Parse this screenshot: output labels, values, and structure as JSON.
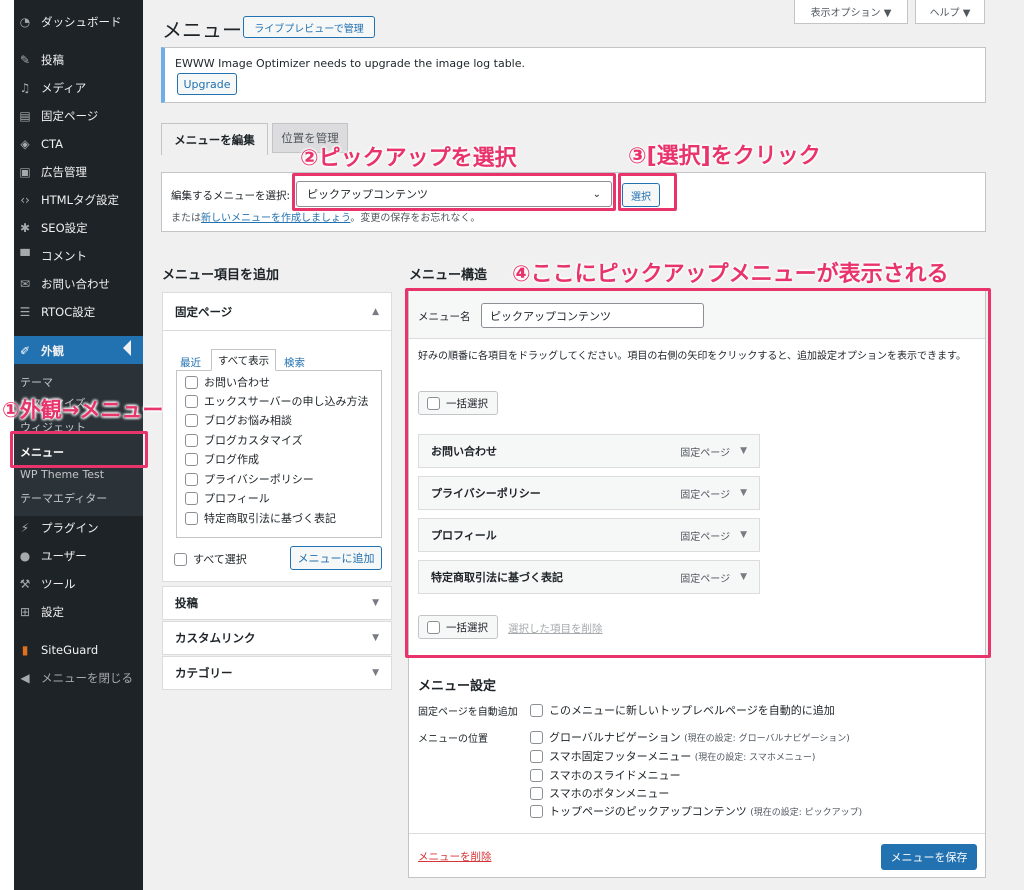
{
  "sidebar": {
    "items": [
      {
        "label": "ダッシュボード",
        "icon": "dashboard-icon"
      },
      {
        "label": "投稿",
        "icon": "pin-icon"
      },
      {
        "label": "メディア",
        "icon": "media-icon"
      },
      {
        "label": "固定ページ",
        "icon": "page-icon"
      },
      {
        "label": "CTA",
        "icon": "cta-icon"
      },
      {
        "label": "広告管理",
        "icon": "ad-icon"
      },
      {
        "label": "HTMLタグ設定",
        "icon": "code-icon"
      },
      {
        "label": "SEO設定",
        "icon": "gear-icon"
      },
      {
        "label": "コメント",
        "icon": "comment-icon"
      },
      {
        "label": "お問い合わせ",
        "icon": "mail-icon"
      },
      {
        "label": "RTOC設定",
        "icon": "list-icon"
      },
      {
        "label": "外観",
        "icon": "appearance-icon"
      },
      {
        "label": "プラグイン",
        "icon": "plugin-icon"
      },
      {
        "label": "ユーザー",
        "icon": "user-icon"
      },
      {
        "label": "ツール",
        "icon": "wrench-icon"
      },
      {
        "label": "設定",
        "icon": "settings-icon"
      },
      {
        "label": "SiteGuard",
        "icon": "siteguard-icon"
      },
      {
        "label": "メニューを閉じる",
        "icon": "collapse-icon"
      }
    ],
    "submenu": [
      "テーマ",
      "カスタマイズ",
      "ウィジェット",
      "メニュー",
      "WP Theme Test",
      "テーマエディター"
    ]
  },
  "header": {
    "title": "メニュー",
    "live_preview": "ライブプレビューで管理",
    "screen_options": "表示オプション ▼",
    "help": "ヘルプ ▼"
  },
  "notice": {
    "text": "EWWW Image Optimizer needs to upgrade the image log table.",
    "button": "Upgrade"
  },
  "tabs": [
    "メニューを編集",
    "位置を管理"
  ],
  "select_menu": {
    "label": "編集するメニューを選択:",
    "value": "ピックアップコンテンツ",
    "button": "選択",
    "or_text": "または",
    "create_link": "新しいメニューを作成しましょう",
    "note": "。変更の保存をお忘れなく。"
  },
  "add_items": {
    "heading": "メニュー項目を追加",
    "panel_title": "固定ページ",
    "tabs": [
      "最近",
      "すべて表示",
      "検索"
    ],
    "pages": [
      "お問い合わせ",
      "エックスサーバーの申し込み方法",
      "ブログお悩み相談",
      "ブログカスタマイズ",
      "ブログ作成",
      "プライバシーポリシー",
      "プロフィール",
      "特定商取引法に基づく表記"
    ],
    "select_all": "すべて選択",
    "add_button": "メニューに追加",
    "other_panels": [
      "投稿",
      "カスタムリンク",
      "カテゴリー"
    ]
  },
  "structure": {
    "heading": "メニュー構造",
    "name_label": "メニュー名",
    "name_value": "ピックアップコンテンツ",
    "instructions": "好みの順番に各項目をドラッグしてください。項目の右側の矢印をクリックすると、追加設定オプションを表示できます。",
    "bulk_select": "一括選択",
    "delete_selected": "選択した項目を削除",
    "items": [
      {
        "title": "お問い合わせ",
        "type": "固定ページ"
      },
      {
        "title": "プライバシーポリシー",
        "type": "固定ページ"
      },
      {
        "title": "プロフィール",
        "type": "固定ページ"
      },
      {
        "title": "特定商取引法に基づく表記",
        "type": "固定ページ"
      }
    ]
  },
  "settings": {
    "heading": "メニュー設定",
    "auto_add_label": "固定ページを自動追加",
    "auto_add_option": "このメニューに新しいトップレベルページを自動的に追加",
    "location_label": "メニューの位置",
    "locations": [
      {
        "name": "グローバルナビゲーション",
        "current": "(現在の設定: グローバルナビゲーション)"
      },
      {
        "name": "スマホ固定フッターメニュー",
        "current": "(現在の設定: スマホメニュー)"
      },
      {
        "name": "スマホのスライドメニュー",
        "current": ""
      },
      {
        "name": "スマホのボタンメニュー",
        "current": ""
      },
      {
        "name": "トップページのピックアップコンテンツ",
        "current": "(現在の設定: ピックアップ)"
      }
    ],
    "delete_link": "メニューを削除",
    "save_button": "メニューを保存"
  },
  "annotations": {
    "a1": "①外観→メニュー",
    "a2": "②ピックアップを選択",
    "a3": "③[選択]をクリック",
    "a4": "④ここにピックアップメニューが表示される"
  },
  "colors": {
    "accent": "#2271b1",
    "annotation": "#e8336b",
    "sidebar": "#1d2327"
  }
}
